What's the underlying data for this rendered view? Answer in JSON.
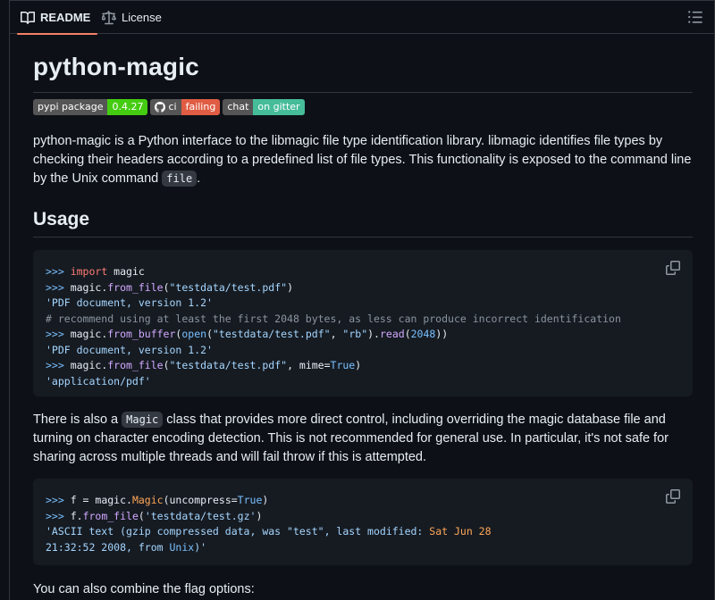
{
  "tabs": {
    "readme": "README",
    "license": "License"
  },
  "readme": {
    "title": "python-magic",
    "badges": {
      "pypi_label": "pypi package",
      "pypi_value": "0.4.27",
      "ci_label": "ci",
      "ci_value": "failing",
      "chat_label": "chat",
      "chat_value": "on gitter"
    },
    "intro_part1": "python-magic is a Python interface to the libmagic file type identification library. libmagic identifies file types by checking their headers according to a predefined list of file types. This functionality is exposed to the command line by the Unix command ",
    "intro_code": "file",
    "intro_end": ".",
    "usage_heading": "Usage",
    "code1": {
      "l1_prompt": ">>> ",
      "l1_kw": "import",
      "l1_rest": " magic",
      "l2_prompt": ">>> ",
      "l2_obj": "magic.",
      "l2_fn": "from_file",
      "l2_open": "(",
      "l2_str": "\"testdata/test.pdf\"",
      "l2_close": ")",
      "l3": "'PDF document, version 1.2'",
      "l4": "# recommend using at least the first 2048 bytes, as less can produce incorrect identification",
      "l5_prompt": ">>> ",
      "l5_obj": "magic.",
      "l5_fn": "from_buffer",
      "l5_a": "(",
      "l5_open": "open",
      "l5_b": "(",
      "l5_str1": "\"testdata/test.pdf\"",
      "l5_comma": ", ",
      "l5_str2": "\"rb\"",
      "l5_c": ").",
      "l5_read": "read",
      "l5_d": "(",
      "l5_num": "2048",
      "l5_e": "))",
      "l6": "'PDF document, version 1.2'",
      "l7_prompt": ">>> ",
      "l7_obj": "magic.",
      "l7_fn": "from_file",
      "l7_open": "(",
      "l7_str": "\"testdata/test.pdf\"",
      "l7_mid": ", mime=",
      "l7_true": "True",
      "l7_close": ")",
      "l8": "'application/pdf'"
    },
    "para2_part1": "There is also a ",
    "para2_code": "Magic",
    "para2_part2": " class that provides more direct control, including overriding the magic database file and turning on character encoding detection. This is not recommended for general use. In particular, it's not safe for sharing across multiple threads and will fail throw if this is attempted.",
    "code2": {
      "l1_prompt": ">>> ",
      "l1_a": "f = magic.",
      "l1_cls": "Magic",
      "l1_b": "(uncompress=",
      "l1_true": "True",
      "l1_c": ")",
      "l2_prompt": ">>> ",
      "l2_a": "f.",
      "l2_fn": "from_file",
      "l2_b": "(",
      "l2_str": "'testdata/test.gz'",
      "l2_c": ")",
      "l3_a": "'ASCII text (gzip compressed data, was ",
      "l3_q": "\"test\"",
      "l3_b": ", last modified: ",
      "l3_date": "Sat Jun 28",
      "l4_a": "21:32:52 2008, from ",
      "l4_unix": "Unix",
      "l4_b": ")'"
    },
    "para3": "You can also combine the flag options:"
  },
  "colors": {
    "accent_tab_underline": "#f78166",
    "background": "#0d1117",
    "code_background": "#161b22"
  },
  "icons": {
    "readme_tab": "book-icon",
    "license_tab": "scale-icon",
    "outline": "list-unordered-icon",
    "copy": "copy-icon",
    "ci_badge": "github-logo-icon"
  }
}
